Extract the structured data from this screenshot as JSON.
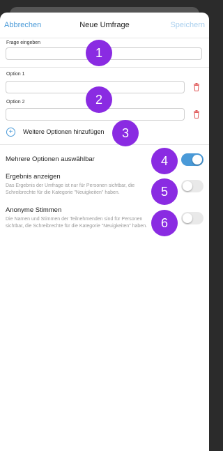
{
  "header": {
    "cancel_label": "Abbrechen",
    "title": "Neue Umfrage",
    "save_label": "Speichern"
  },
  "question": {
    "label": "Frage eingeben",
    "value": ""
  },
  "options": [
    {
      "label": "Option 1",
      "value": ""
    },
    {
      "label": "Option 2",
      "value": ""
    }
  ],
  "add_option_label": "Weitere Optionen hinzufügen",
  "settings": [
    {
      "title": "Mehrere Optionen auswählbar",
      "description": "",
      "enabled": true
    },
    {
      "title": "Ergebnis anzeigen",
      "description": "Das Ergebnis der Umfrage ist nur für Personen sichtbar, die Schreibrechte für die Kategorie \"Neuigkeiten\" haben.",
      "enabled": false
    },
    {
      "title": "Anonyme Stimmen",
      "description": "Die Namen und Stimmen der Teilnehmenden sind für Personen sichtbar, die Schreibrechte für die Kategorie \"Neuigkeiten\" haben.",
      "enabled": false
    }
  ],
  "markers": [
    "1",
    "2",
    "3",
    "4",
    "5",
    "6"
  ],
  "colors": {
    "accent": "#4a9ad8",
    "marker": "#8a2be2",
    "delete": "#e05a5a"
  },
  "icons": [
    "plus-circle-icon",
    "trash-icon"
  ]
}
